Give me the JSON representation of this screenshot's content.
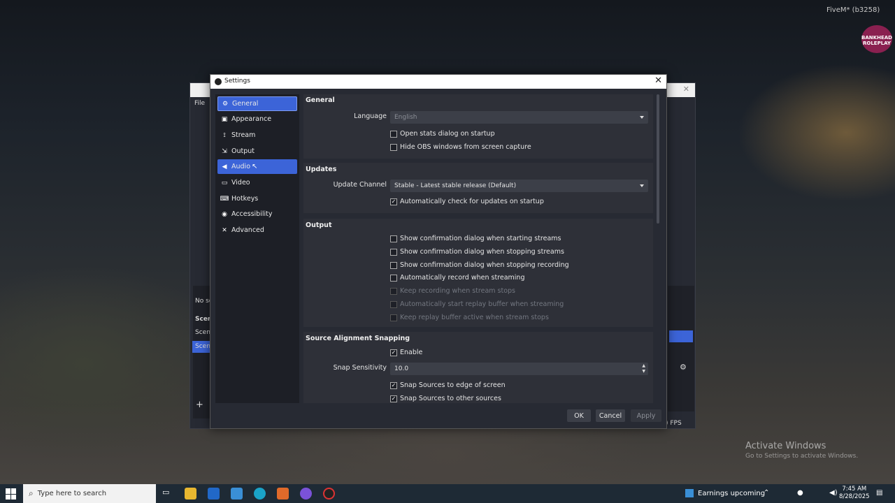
{
  "overlay": {
    "fivem_title": "FiveM* (b3258)",
    "logo_text": "BANKHEAD ROLEPLAY",
    "activate_title": "Activate Windows",
    "activate_sub": "Go to Settings to activate Windows."
  },
  "obs_main": {
    "menu_file": "File",
    "left_labels": [
      "No sc",
      "Scen",
      "Scen",
      "Scen"
    ],
    "fps_text": ") FPS"
  },
  "settings": {
    "title": "Settings",
    "close_glyph": "✕",
    "nav": [
      {
        "label": "General",
        "icon": "gear-icon",
        "glyph": "⚙"
      },
      {
        "label": "Appearance",
        "icon": "appearance-icon",
        "glyph": "▣"
      },
      {
        "label": "Stream",
        "icon": "antenna-icon",
        "glyph": "⟟"
      },
      {
        "label": "Output",
        "icon": "output-icon",
        "glyph": "⇲"
      },
      {
        "label": "Audio",
        "icon": "speaker-icon",
        "glyph": "🔊"
      },
      {
        "label": "Video",
        "icon": "monitor-icon",
        "glyph": "▭"
      },
      {
        "label": "Hotkeys",
        "icon": "keyboard-icon",
        "glyph": "⌨"
      },
      {
        "label": "Accessibility",
        "icon": "accessibility-icon",
        "glyph": "♿"
      },
      {
        "label": "Advanced",
        "icon": "wrench-icon",
        "glyph": "✕"
      }
    ],
    "general": {
      "title": "General",
      "language_label": "Language",
      "language_value": "English",
      "open_stats_label": "Open stats dialog on startup",
      "open_stats_checked": false,
      "hide_obs_label": "Hide OBS windows from screen capture",
      "hide_obs_checked": false
    },
    "updates": {
      "title": "Updates",
      "channel_label": "Update Channel",
      "channel_value": "Stable - Latest stable release (Default)",
      "auto_check_label": "Automatically check for updates on startup",
      "auto_check_checked": true
    },
    "output": {
      "title": "Output",
      "items": [
        {
          "label": "Show confirmation dialog when starting streams",
          "checked": false,
          "disabled": false
        },
        {
          "label": "Show confirmation dialog when stopping streams",
          "checked": false,
          "disabled": false
        },
        {
          "label": "Show confirmation dialog when stopping recording",
          "checked": false,
          "disabled": false
        },
        {
          "label": "Automatically record when streaming",
          "checked": false,
          "disabled": false
        },
        {
          "label": "Keep recording when stream stops",
          "checked": false,
          "disabled": true
        },
        {
          "label": "Automatically start replay buffer when streaming",
          "checked": false,
          "disabled": true
        },
        {
          "label": "Keep replay buffer active when stream stops",
          "checked": false,
          "disabled": true
        }
      ]
    },
    "snapping": {
      "title": "Source Alignment Snapping",
      "enable_label": "Enable",
      "enable_checked": true,
      "sensitivity_label": "Snap Sensitivity",
      "sensitivity_value": "10.0",
      "edge_label": "Snap Sources to edge of screen",
      "edge_checked": true,
      "other_label": "Snap Sources to other sources",
      "other_checked": true
    },
    "buttons": {
      "ok": "OK",
      "cancel": "Cancel",
      "apply": "Apply"
    }
  },
  "taskbar": {
    "search_placeholder": "Type here to search",
    "earnings": "Earnings upcoming",
    "time": "7:45 AM",
    "date": "8/28/2025"
  },
  "colors": {
    "accent": "#3c64d8",
    "dialog_bg": "#272a33",
    "section_bg": "#2e3038"
  }
}
